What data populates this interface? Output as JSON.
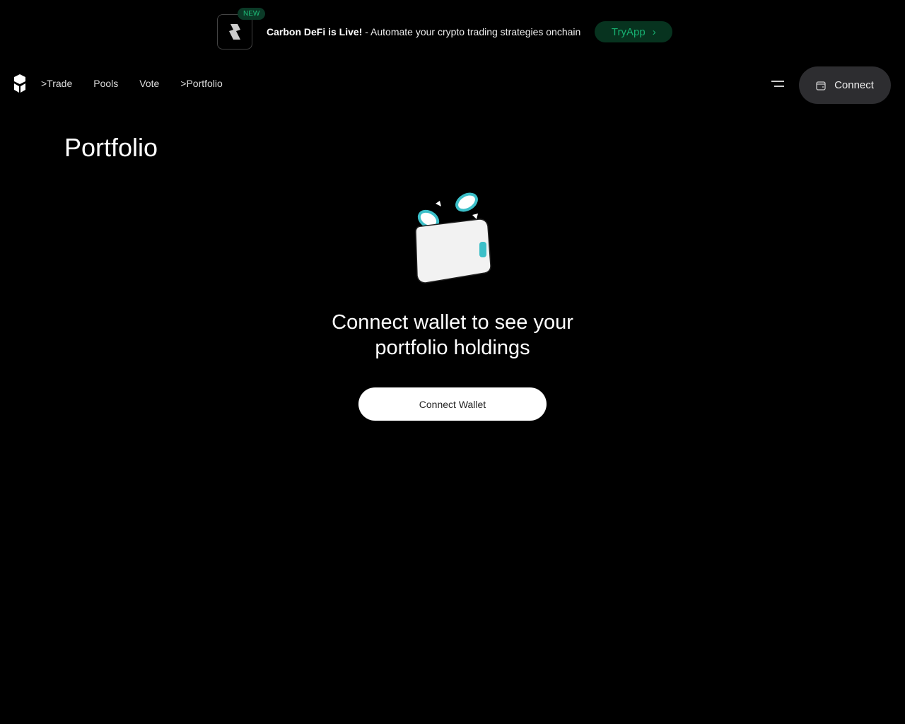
{
  "banner": {
    "badge": "NEW",
    "title": "Carbon DeFi is Live!",
    "text": " - Automate your crypto trading strategies onchain",
    "cta": "TryApp"
  },
  "nav": {
    "items": [
      ">Trade",
      "Pools",
      "Vote",
      ">Portfolio"
    ],
    "connect": "Connect"
  },
  "main": {
    "title": "Portfolio",
    "message_line1": "Connect wallet to see your",
    "message_line2": "portfolio holdings",
    "button": "Connect Wallet"
  }
}
